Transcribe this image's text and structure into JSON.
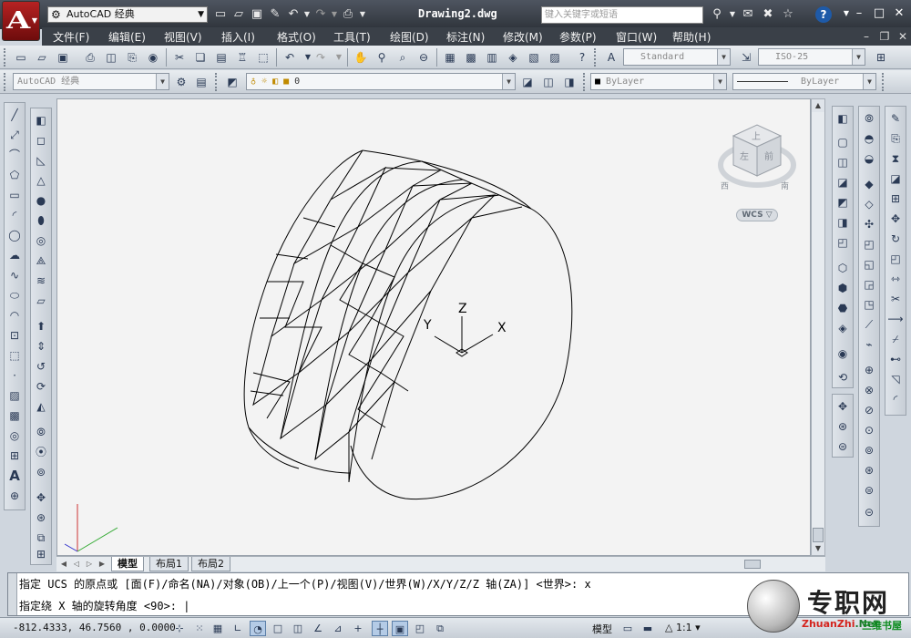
{
  "app": {
    "logo_letter": "A",
    "workspace": "AutoCAD 经典",
    "document_title": "Drawing2.dwg",
    "search_placeholder": "键入关键字或短语",
    "help": "?"
  },
  "menu": [
    "文件(F)",
    "编辑(E)",
    "视图(V)",
    "插入(I)",
    "格式(O)",
    "工具(T)",
    "绘图(D)",
    "标注(N)",
    "修改(M)",
    "参数(P)",
    "窗口(W)",
    "帮助(H)"
  ],
  "toolbar": {
    "text_style": "Standard",
    "dim_style": "ISO-25",
    "workspace_combo": "AutoCAD 经典",
    "layer_value": "0",
    "color": "ByLayer",
    "linetype": "ByLayer"
  },
  "viewport": {
    "viewcube": {
      "top": "上",
      "left": "左",
      "front": "前",
      "south": "南",
      "west": "西"
    },
    "wcs_label": "WCS",
    "ucs": {
      "x": "X",
      "y": "Y",
      "z": "Z"
    }
  },
  "layout_tabs": [
    "模型",
    "布局1",
    "布局2"
  ],
  "command": {
    "history": "指定 UCS 的原点或 [面(F)/命名(NA)/对象(OB)/上一个(P)/视图(V)/世界(W)/X/Y/Z/Z 轴(ZA)] <世界>: x",
    "prompt": "指定绕 X 轴的旋转角度 <90>: |"
  },
  "status": {
    "coordinates": "-812.4333, 46.7560 , 0.0000",
    "model": "模型",
    "scale": "1:1"
  },
  "watermark": {
    "brand_cn": "专职网",
    "brand_en": "ZhuanZhi",
    "brand_en2": ".Net",
    "brand_sub": "三维书屋"
  },
  "colors": {
    "title_bar": "#3a4048",
    "canvas": "#f3f3f3",
    "app_button": "#a01818"
  }
}
